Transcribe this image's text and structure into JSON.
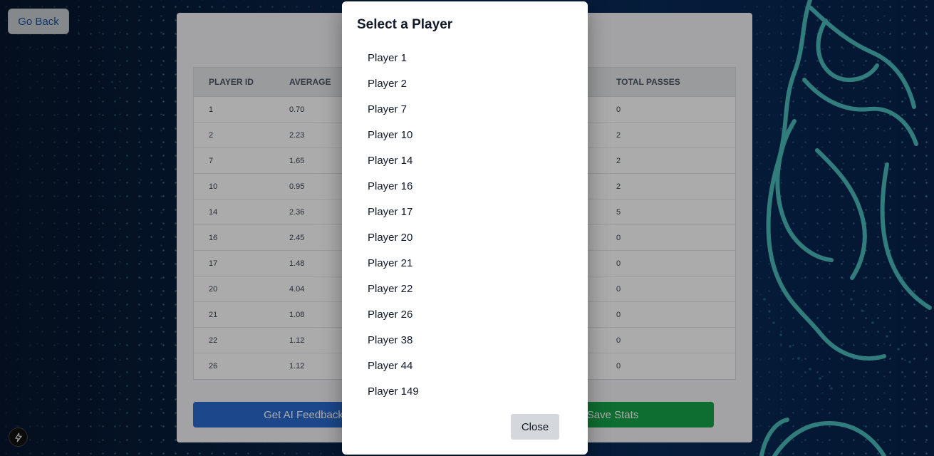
{
  "header": {
    "go_back_label": "Go Back"
  },
  "table": {
    "headers": [
      "PLAYER ID",
      "AVERAGE",
      "TOTAL PASSES"
    ],
    "rows": [
      {
        "id": "1",
        "avg": "0.70",
        "passes": "0"
      },
      {
        "id": "2",
        "avg": "2.23",
        "passes": "2"
      },
      {
        "id": "7",
        "avg": "1.65",
        "passes": "2"
      },
      {
        "id": "10",
        "avg": "0.95",
        "passes": "2"
      },
      {
        "id": "14",
        "avg": "2.36",
        "passes": "5"
      },
      {
        "id": "16",
        "avg": "2.45",
        "passes": "0"
      },
      {
        "id": "17",
        "avg": "1.48",
        "passes": "0"
      },
      {
        "id": "20",
        "avg": "4.04",
        "passes": "0"
      },
      {
        "id": "21",
        "avg": "1.08",
        "passes": "0"
      },
      {
        "id": "22",
        "avg": "1.12",
        "passes": "0"
      },
      {
        "id": "26",
        "avg": "1.12",
        "passes": "0"
      }
    ]
  },
  "actions": {
    "ai_feedback_label": "Get AI Feedback",
    "save_stats_label": "Save Stats"
  },
  "modal": {
    "title": "Select a Player",
    "players": [
      "Player 1",
      "Player 2",
      "Player 7",
      "Player 10",
      "Player 14",
      "Player 16",
      "Player 17",
      "Player 20",
      "Player 21",
      "Player 22",
      "Player 26",
      "Player 38",
      "Player 44",
      "Player 149"
    ],
    "close_label": "Close"
  },
  "icons": {
    "floating_action": "lightning-bolt-icon"
  },
  "colors": {
    "primary": "#2b6bd0",
    "success": "#16a34a",
    "background": "#071a33",
    "accent": "#5fd2d2"
  }
}
